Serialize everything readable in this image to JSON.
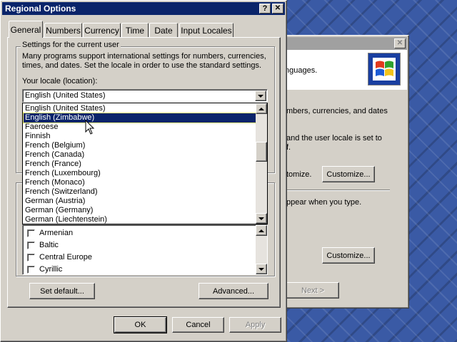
{
  "dialog": {
    "title": "Regional Options",
    "caption_help": "?",
    "caption_close": "✕",
    "tabs": [
      "General",
      "Numbers",
      "Currency",
      "Time",
      "Date",
      "Input Locales"
    ],
    "active_tab": "General",
    "group_title": "Settings for the current user",
    "description_line1": "Many programs support international settings for numbers, currencies,",
    "description_line2": "times, and dates. Set the locale in order to use the standard settings.",
    "locale_label": "Your locale (location):",
    "locale_value": "English (United States)",
    "locale_options": [
      "English (United States)",
      "English (Zimbabwe)",
      "Faeroese",
      "Finnish",
      "French (Belgium)",
      "French (Canada)",
      "French (France)",
      "French (Luxembourg)",
      "French (Monaco)",
      "French (Switzerland)",
      "German (Austria)",
      "German (Germany)",
      "German (Liechtenstein)"
    ],
    "highlighted_option": "English (Zimbabwe)",
    "language_settings": [
      "Armenian",
      "Baltic",
      "Central Europe",
      "Cyrillic"
    ],
    "set_default_button": "Set default...",
    "advanced_button": "Advanced...",
    "ok_button": "OK",
    "cancel_button": "Cancel",
    "apply_button": "Apply"
  },
  "background_window": {
    "close": "✕",
    "text_languages": "nguages.",
    "text_numbers": "mbers, currencies, and dates",
    "text_locale_line1": "and the user locale is set to",
    "text_locale_line2": "f.",
    "text_customize_prefix": "tomize.",
    "customize_button_1": "Customize...",
    "text_appear": "ppear when you type.",
    "customize_button_2": "Customize...",
    "next_button": "Next >"
  },
  "colors": {
    "titlebar_active": "#0a246a",
    "titlebar_inactive": "#a0a0a0",
    "face": "#d4d0c8",
    "desktop": "#3a5aa5"
  }
}
